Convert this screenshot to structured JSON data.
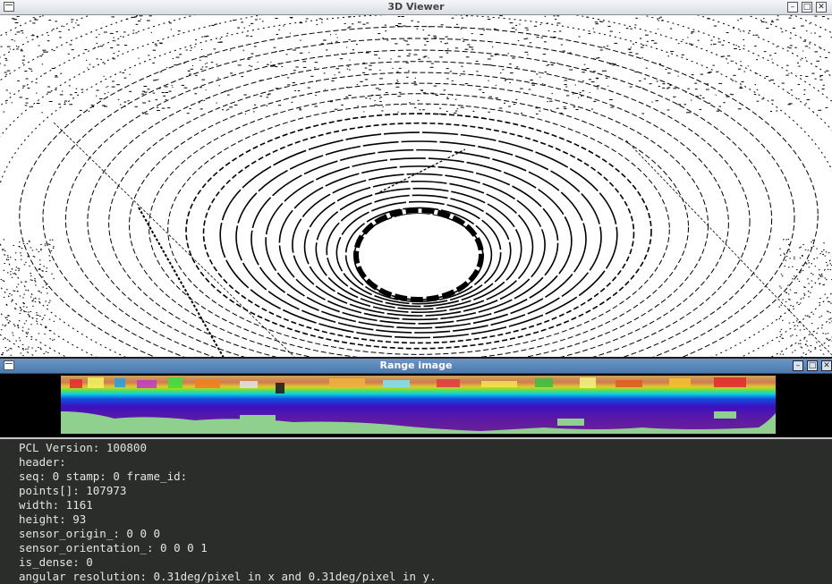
{
  "viewer": {
    "title": "3D Viewer",
    "controls": [
      "–",
      "□",
      "✕"
    ]
  },
  "range_image": {
    "title": "Range image",
    "controls": [
      "–",
      "□",
      "✕"
    ]
  },
  "console": {
    "lines": [
      "PCL Version: 100800",
      "header:",
      "seq: 0 stamp: 0 frame_id:",
      "points[]: 107973",
      "width: 1161",
      "height: 93",
      "sensor_origin_: 0 0 0",
      "sensor_orientation_: 0 0 0 1",
      "is_dense: 0",
      "angular resolution: 0.31deg/pixel in x and 0.31deg/pixel in y."
    ]
  },
  "colors": {
    "viewer_background": "#ffffff",
    "points": "#000000",
    "console_background": "#2b2d2b",
    "console_text": "#e4e4e4",
    "range_background": "#000000",
    "range_nodata": "#8fd08f"
  }
}
